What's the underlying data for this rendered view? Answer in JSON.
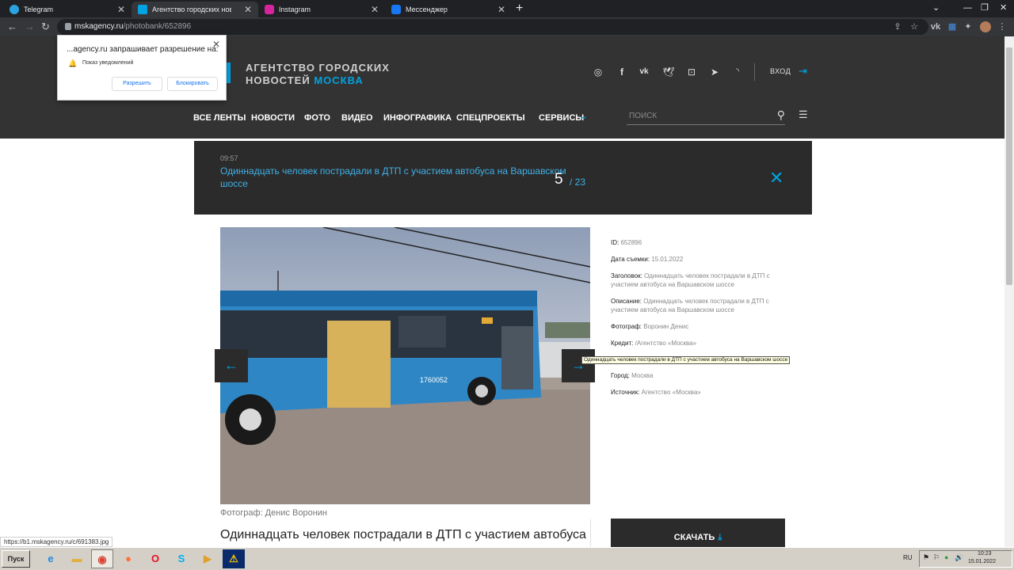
{
  "browser": {
    "tabs": [
      {
        "label": "Telegram",
        "color": "#2aa3e0"
      },
      {
        "label": "Агентство городских новостей «Москва»",
        "color": "#00a3e0"
      },
      {
        "label": "Instagram",
        "color": "#d6249f"
      },
      {
        "label": "Мессенджер",
        "color": "#1877f2"
      }
    ],
    "url_host": "mskagency.ru",
    "url_path": "/photobank/652896"
  },
  "notification": {
    "title": "...agency.ru запрашивает разрешение на:",
    "item": "Показ уведомлений",
    "allow": "Разрешить",
    "block": "Блокировать"
  },
  "site": {
    "logo_line1": "АГЕНТСТВО ГОРОДСКИХ",
    "logo_line2": "НОВОСТЕЙ",
    "logo_accent": "МОСКВА",
    "login": "ВХОД",
    "nav": [
      "ВСЕ ЛЕНТЫ",
      "НОВОСТИ",
      "ФОТО",
      "ВИДЕО",
      "ИНФОГРАФИКА",
      "СПЕЦПРОЕКТЫ",
      "СЕРВИСЫ"
    ],
    "search_placeholder": "ПОИСК",
    "accent_color": "#00a3e0"
  },
  "banner": {
    "time": "09:57",
    "title": "Одиннадцать человек пострадали в ДТП с участием автобуса на Варшавском шоссе",
    "current": "5",
    "total": "/ 23"
  },
  "photo": {
    "caption": "Фотограф: Денис Воронин",
    "headline": "Одиннадцать человек пострадали в ДТП с участием автобуса",
    "bus_number": "1760052"
  },
  "meta": [
    {
      "label": "ID:",
      "value": "652896"
    },
    {
      "label": "Дата съемки:",
      "value": "15.01.2022"
    },
    {
      "label": "Заголовок:",
      "value": "Одиннадцать человек пострадали в ДТП с участием автобуса на Варшавском шоссе"
    },
    {
      "label": "Описание:",
      "value": "Одиннадцать человек пострадали в ДТП с участием автобуса на Варшавском шоссе"
    },
    {
      "label": "Фотограф:",
      "value": "Воронин Денис"
    },
    {
      "label": "Кредит:",
      "value": "/Агентство «Москва»"
    },
    {
      "label": "Город:",
      "value": "Москва"
    },
    {
      "label": "Источник:",
      "value": "Агентство «Москва»"
    }
  ],
  "tooltip": "Одиннадцать человек пострадали в ДТП с участием автобуса на Варшавском шоссе",
  "download": "СКАЧАТЬ",
  "status_url": "https://b1.mskagency.ru/c/691383.jpg",
  "taskbar": {
    "start": "Пуск",
    "lang": "RU",
    "time": "10:23",
    "date": "15.01.2022"
  }
}
